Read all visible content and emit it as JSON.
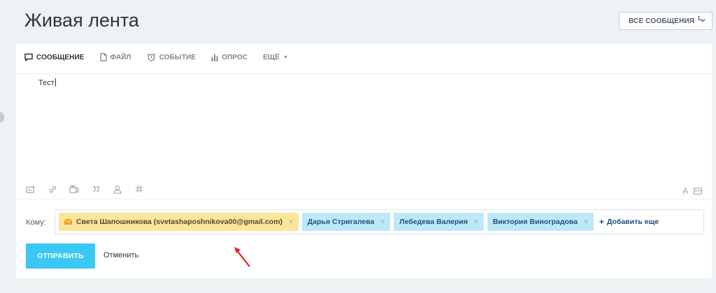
{
  "page": {
    "title": "Живая лента"
  },
  "filter": {
    "label": "ВСЕ СООБЩЕНИЯ",
    "count": "1"
  },
  "tabs": [
    {
      "label": "СООБЩЕНИЕ",
      "icon": "message-icon"
    },
    {
      "label": "ФАЙЛ",
      "icon": "file-icon"
    },
    {
      "label": "СОБЫТИЕ",
      "icon": "alarm-clock-icon"
    },
    {
      "label": "ОПРОС",
      "icon": "poll-icon"
    },
    {
      "label": "ЕЩЁ",
      "icon": "caret-down-icon"
    }
  ],
  "editor": {
    "text": "Тест"
  },
  "toolbar_icons": [
    "image-upload-icon",
    "link-icon",
    "video-icon",
    "quote-icon",
    "mention-user-icon",
    "hashtag-icon"
  ],
  "format": {
    "font_label": "A"
  },
  "recipients": {
    "label": "Кому:",
    "chips": [
      {
        "name": "Света Шапошникова (svetashaposhnikova00@gmail.com)",
        "type": "email"
      },
      {
        "name": "Дарья Стригалева",
        "type": "user"
      },
      {
        "name": "Лебедева Валерия",
        "type": "user"
      },
      {
        "name": "Виктория Виноградова",
        "type": "user"
      }
    ],
    "remove_symbol": "×",
    "add_more": "Добавить еще",
    "add_symbol": "+"
  },
  "actions": {
    "send": "ОТПРАВИТЬ",
    "cancel": "Отменить"
  },
  "colors": {
    "send_button": "#3bc8f5",
    "email_chip": "#fbe59a",
    "user_chip": "#bde8f8",
    "annotation_arrow": "#e02020"
  }
}
